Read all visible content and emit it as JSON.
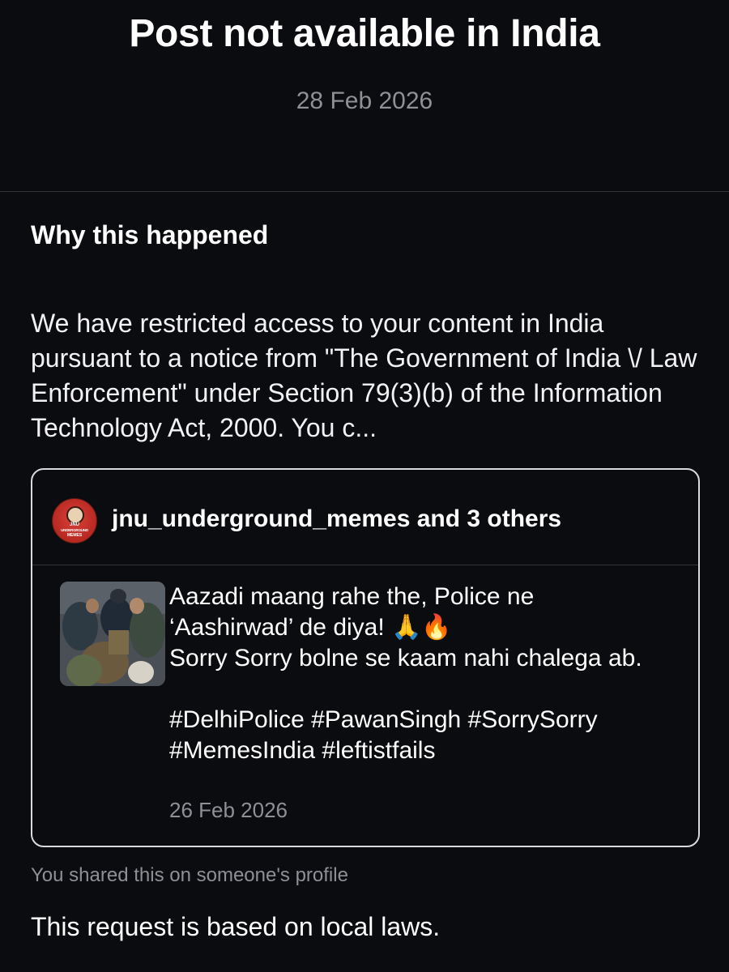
{
  "header": {
    "title": "Post not available in India",
    "date": "28 Feb 2026"
  },
  "reason": {
    "heading": "Why this happened",
    "body": "We have restricted access to your content in India pursuant to a notice from \"The Government of India \\/ Law Enforcement\" under Section 79(3)(b) of the Information Technology Act, 2000. You c..."
  },
  "post_card": {
    "shared_by": "jnu_underground_memes and 3 others",
    "avatar": {
      "icon": "jnu-underground-memes-logo",
      "logo_text": [
        "JNU",
        "UNDERGROUND",
        "MEMES"
      ]
    },
    "thumbnail_icon": "post-thumbnail-image",
    "text": "Aazadi maang rahe the, Police ne\n‘Aashirwad’ de diya! 🙏🔥\nSorry Sorry bolne se kaam nahi chalega ab.\n\n#DelhiPolice #PawanSingh #SorrySorry #MemesIndia #leftistfails",
    "date": "26 Feb 2026"
  },
  "footnote": "You shared this on someone's profile",
  "local_laws": "This request is based on local laws.",
  "colors": {
    "background": "#0b0c10",
    "muted_text": "#8e9098",
    "card_border": "#d9d9de",
    "avatar_red": "#c7302a"
  }
}
